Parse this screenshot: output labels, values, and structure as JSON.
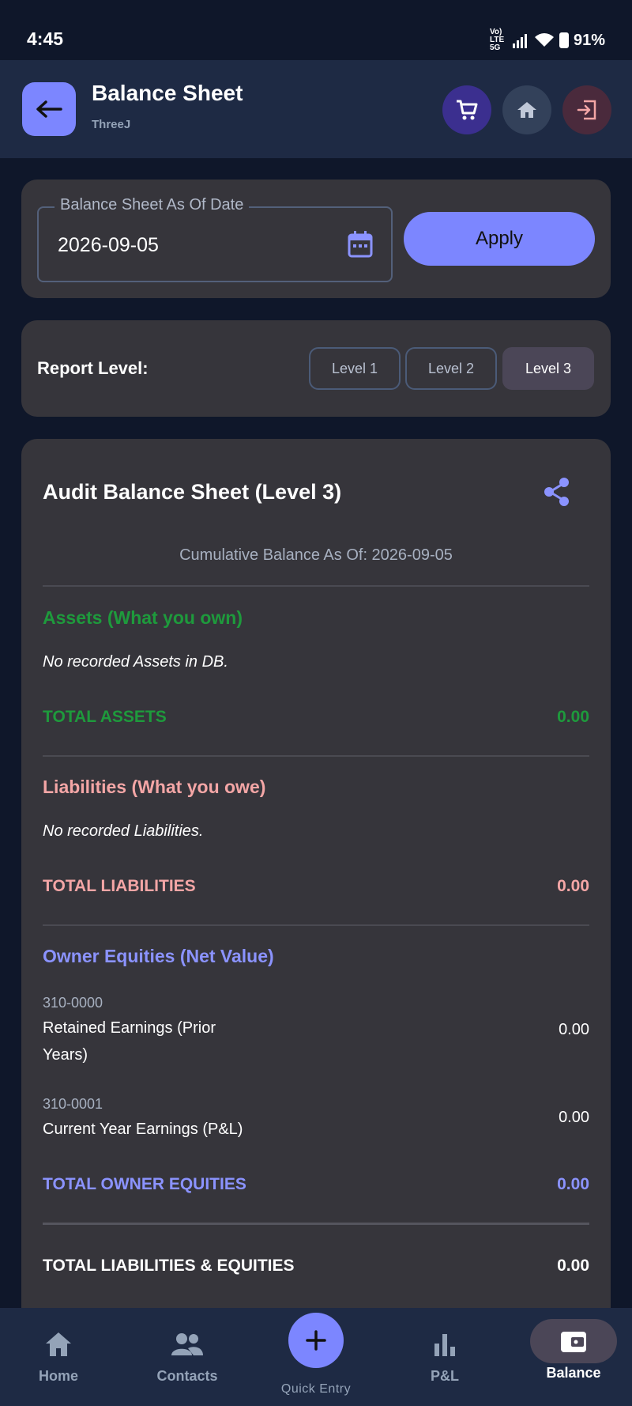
{
  "status_bar": {
    "time": "4:45",
    "network": "Vo) LTE 5G",
    "battery": "91%"
  },
  "header": {
    "title": "Balance Sheet",
    "subtitle": "ThreeJ"
  },
  "date_filter": {
    "label": "Balance Sheet As Of Date",
    "value": "2026-09-05",
    "apply_label": "Apply"
  },
  "report_level": {
    "label": "Report Level:",
    "levels": [
      "Level 1",
      "Level 2",
      "Level 3"
    ],
    "selected": "Level 3"
  },
  "report": {
    "title": "Audit Balance Sheet (Level 3)",
    "cumulative": "Cumulative Balance As Of: 2026-09-05",
    "assets": {
      "title": "Assets (What you own)",
      "empty": "No recorded Assets in DB.",
      "total_label": "TOTAL ASSETS",
      "total_value": "0.00"
    },
    "liabilities": {
      "title": "Liabilities (What you owe)",
      "empty": "No recorded Liabilities.",
      "total_label": "TOTAL LIABILITIES",
      "total_value": "0.00"
    },
    "equities": {
      "title": "Owner Equities (Net Value)",
      "accounts": [
        {
          "code": "310-0000",
          "name": "Retained Earnings (Prior Years)",
          "value": "0.00"
        },
        {
          "code": "310-0001",
          "name": "Current Year Earnings (P&L)",
          "value": "0.00"
        }
      ],
      "total_label": "TOTAL OWNER EQUITIES",
      "total_value": "0.00"
    },
    "grand_total_label": "TOTAL LIABILITIES & EQUITIES",
    "grand_total_value": "0.00"
  },
  "nav": {
    "items": [
      "Home",
      "Contacts",
      "Quick Entry",
      "P&L",
      "Balance"
    ],
    "active": "Balance"
  },
  "colors": {
    "accent": "#7c86ff",
    "assets": "#1e9a3c",
    "liabilities": "#f4a6a6",
    "equities": "#8b93ff"
  }
}
